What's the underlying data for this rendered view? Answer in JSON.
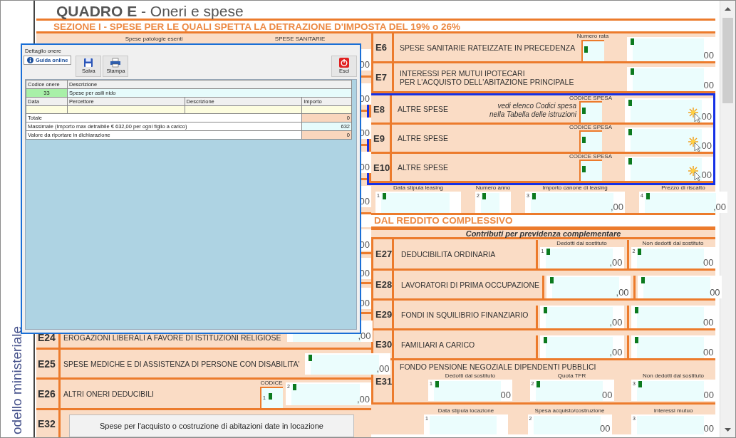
{
  "side_label": "odello ministeriale",
  "title": "**QUADRO E** - Oneri e spese",
  "section_1": {
    "heading": "SEZIONE I  -  SPESE PER LE QUALI SPETTA LA DETRAZIONE D'IMPOSTA DEL 19% o 26%",
    "left_headers": [
      "Spese patologie esenti",
      "SPESE SANITARIE"
    ],
    "left_rows": [
      {
        "amount": "00"
      },
      {
        "amount": "00"
      },
      {
        "amount": "00"
      },
      {
        "amount": "00"
      },
      {
        "amount": "00"
      }
    ],
    "rows": [
      {
        "code": "E6",
        "label": [
          "SPESE SANITARIE RATEIZZATE IN PRECEDENZA"
        ],
        "code_caption": "Numero rata",
        "amount": "00",
        "highlighted": false,
        "cursor": false
      },
      {
        "code": "E7",
        "label": [
          "INTERESSI PER MUTUI IPOTECARI",
          "PER L'ACQUISTO DELL'ABITAZIONE PRINCIPALE"
        ],
        "amount": "00",
        "highlighted": false,
        "cursor": false
      },
      {
        "code": "E8",
        "label": [
          "ALTRE SPESE"
        ],
        "note": [
          "vedi elenco Codici spesa",
          "nella Tabella delle istruzioni"
        ],
        "code_caption": "CODICE SPESA",
        "amount": "00",
        "highlighted": true,
        "cursor": true
      },
      {
        "code": "E9",
        "label": [
          "ALTRE SPESE"
        ],
        "code_caption": "CODICE SPESA",
        "amount": "00",
        "highlighted": true,
        "cursor": true
      },
      {
        "code": "E10",
        "label": [
          "ALTRE SPESE"
        ],
        "code_caption": "CODICE SPESA",
        "amount": "00",
        "highlighted": true,
        "cursor": true
      }
    ],
    "leasing": [
      {
        "caption": "Data stipula leasing",
        "number": "1",
        "marker": true
      },
      {
        "caption": "Numero anno",
        "number": "2",
        "marker": true
      },
      {
        "caption": "Importo canone di leasing",
        "number": "3",
        "marker": true,
        "amount": ",00"
      },
      {
        "caption": "Prezzo di riscatto",
        "number": "4",
        "marker": true,
        "amount": ",00"
      }
    ]
  },
  "section_2": {
    "heading": "DAL REDDITO COMPLESSIVO",
    "subheading": "Contributi per previdenza complementare",
    "column_captions": [
      "Dedotti dal sostituto",
      "Non dedotti dal sostituto"
    ],
    "left_rows": [
      {
        "amount": "00"
      },
      {
        "amount": "00"
      },
      {
        "amount": "00"
      }
    ],
    "rows": [
      {
        "code": "E27",
        "label": "DEDUCIBILITA ORDINARIA",
        "fields": [
          {
            "number": "1",
            "amount": ",00"
          },
          {
            "number": "2",
            "amount": "00"
          }
        ]
      },
      {
        "code": "E28",
        "label": "LAVORATORI DI PRIMA OCCUPAZIONE",
        "fields": [
          {
            "amount": ",00"
          },
          {
            "amount": "00"
          }
        ]
      },
      {
        "code": "E29",
        "label": "FONDI IN SQUILIBRIO FINANZIARIO",
        "fields": [
          {
            "amount": ",00"
          },
          {
            "amount": "00"
          }
        ]
      },
      {
        "code": "E30",
        "label": "FAMILIARI A CARICO",
        "fields": [
          {
            "amount": ",00"
          },
          {
            "amount": "00"
          }
        ]
      }
    ],
    "e31": {
      "code": "E31",
      "label": "FONDO PENSIONE NEGOZIALE DIPENDENTI PUBBLICI",
      "fields": [
        {
          "caption": "Dedotti dal sostituto",
          "number": "1",
          "amount": "00"
        },
        {
          "caption": "Quota TFR",
          "number": "2",
          "amount": "00"
        },
        {
          "caption": "Non dedotti dal sostituto",
          "number": "3",
          "amount": "00"
        }
      ]
    },
    "locazione": [
      {
        "caption": "Data stipula locazione",
        "number": "1"
      },
      {
        "caption": "Spesa acquisto/costruzione",
        "number": "2",
        "amount": "00"
      },
      {
        "caption": "Interessi mutuo",
        "number": "3",
        "amount": "00"
      }
    ],
    "left_bottom": [
      {
        "kind": "amount",
        "code": "E24",
        "label": "EROGAZIONI LIBERALI A FAVORE DI ISTITUZIONI RELIGIOSE",
        "amount": ",00"
      },
      {
        "kind": "amount",
        "code": "E25",
        "label": "SPESE MEDICHE E DI ASSISTENZA DI PERSONE CON DISABILITA'",
        "amount": ",00"
      },
      {
        "kind": "coded",
        "code": "E26",
        "label": "ALTRI ONERI DEDUCIBILI",
        "code_caption": "CODICE",
        "code_number": "1",
        "amount_number": "2",
        "amount": ",00"
      },
      {
        "kind": "button",
        "code": "E32",
        "button": "Spese per l'acquisto o costruzione di abitazioni date in locazione"
      }
    ]
  },
  "dialog": {
    "title": "Dettaglio onere",
    "buttons": [
      {
        "kind": "help",
        "label": "Guida online"
      },
      {
        "kind": "save",
        "label": "Salva"
      },
      {
        "kind": "print",
        "label": "Stampa"
      },
      {
        "kind": "exit",
        "label": "Esci"
      }
    ],
    "code_header": "Codice onere",
    "description_header": "Descrizione",
    "code": "33",
    "description": "Spese per asili nido",
    "columns": [
      "Data",
      "Percettore",
      "Descrizione",
      "Importo"
    ],
    "summary": [
      {
        "kind": "total",
        "label": "Totale",
        "value": "0"
      },
      {
        "kind": "limit",
        "label": "Massimale (Importo max detraibile € 632,00 per ogni figlio a carico)",
        "value": "632"
      },
      {
        "kind": "total",
        "label": "Valore da riportare in dichiarazione",
        "value": "0"
      }
    ]
  }
}
